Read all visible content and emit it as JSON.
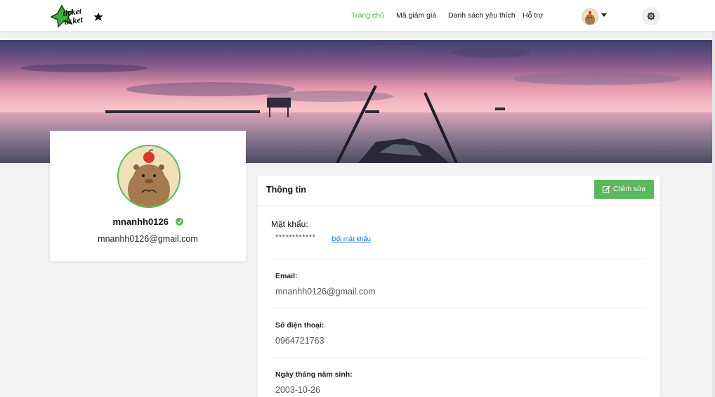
{
  "nav": {
    "logo_text": "ticket ticket",
    "links": [
      {
        "label": "Trang chủ",
        "active": true
      },
      {
        "label": "Mã giảm giá",
        "active": false
      },
      {
        "label": "Danh sách yêu thích",
        "active": false
      },
      {
        "label": "Hỗ trợ",
        "active": false
      }
    ],
    "accent_color": "#4cae4c"
  },
  "profile": {
    "username": "mnanhh0126",
    "email": "mnanhh0126@gmail.com",
    "verified": true
  },
  "info": {
    "title": "Thông tin",
    "edit_label": "Chỉnh sửa",
    "password": {
      "label": "Mật khẩu:",
      "masked_value": "************",
      "change_link": "Đổi mật khẩu"
    },
    "email": {
      "label": "Email:",
      "value": "mnanhh0126@gmail.com"
    },
    "phone": {
      "label": "Số điện thoại:",
      "value": "0964721763"
    },
    "birthday": {
      "label": "Ngày tháng năm sinh:",
      "value": "2003-10-26"
    }
  },
  "colors": {
    "button_green": "#5cb85c",
    "link_blue": "#1a6fd1"
  }
}
